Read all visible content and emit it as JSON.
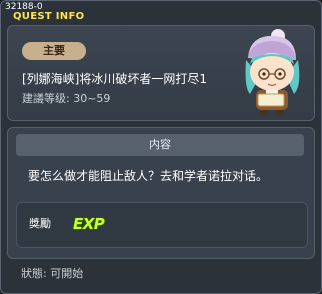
{
  "window": {
    "quest_id": "32188-0",
    "title": "QUEST INFO"
  },
  "quest": {
    "category": "主要",
    "name": "[列娜海峡]将冰川破坏者一网打尽1",
    "level_range": "建議等级: 30~59"
  },
  "content": {
    "header": "内容",
    "description": "要怎么做才能阻止敌人？去和学者诺拉对话。",
    "reward_label": "獎勵",
    "reward_icon": "exp-icon",
    "reward_icon_text": "EXP"
  },
  "status": {
    "text": "狀態: 可開始"
  },
  "colors": {
    "title": "#ffe34d",
    "badge": "#c8b08e",
    "exp": "#c8ff2a"
  }
}
